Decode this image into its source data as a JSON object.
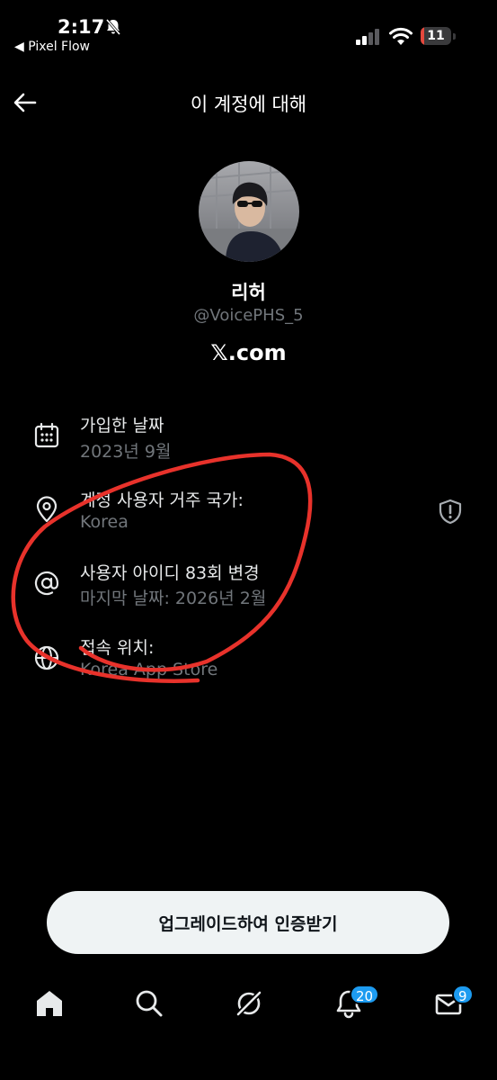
{
  "status_bar": {
    "time": "2:17",
    "back_app": "◀ Pixel Flow",
    "battery": "11",
    "battery_level": 0.11
  },
  "header": {
    "title": "이 계정에 대해"
  },
  "profile": {
    "name": "리허",
    "handle": "@VoicePHS_5",
    "brand": "𝕏.com"
  },
  "rows": [
    {
      "icon": "calendar-icon",
      "title": "가입한 날짜",
      "subtitle": "2023년 9월"
    },
    {
      "icon": "location-pin-icon",
      "title": "계정 사용자 거주 국가:",
      "subtitle": "Korea"
    },
    {
      "icon": "at-sign-icon",
      "title": "사용자 아이디 83회 변경",
      "subtitle": "마지막 날짜: 2026년 2월"
    },
    {
      "icon": "globe-icon",
      "title": "접속 위치:",
      "subtitle": "Korea App Store"
    }
  ],
  "upgrade_button": "업그레이드하여 인증받기",
  "nav": {
    "notifications_badge": "20",
    "messages_badge": "9"
  },
  "colors": {
    "background": "#000000",
    "text_primary": "#e7e9ea",
    "text_secondary": "#71767b",
    "accent": "#1d9bf0",
    "annotation": "#e8322b"
  }
}
